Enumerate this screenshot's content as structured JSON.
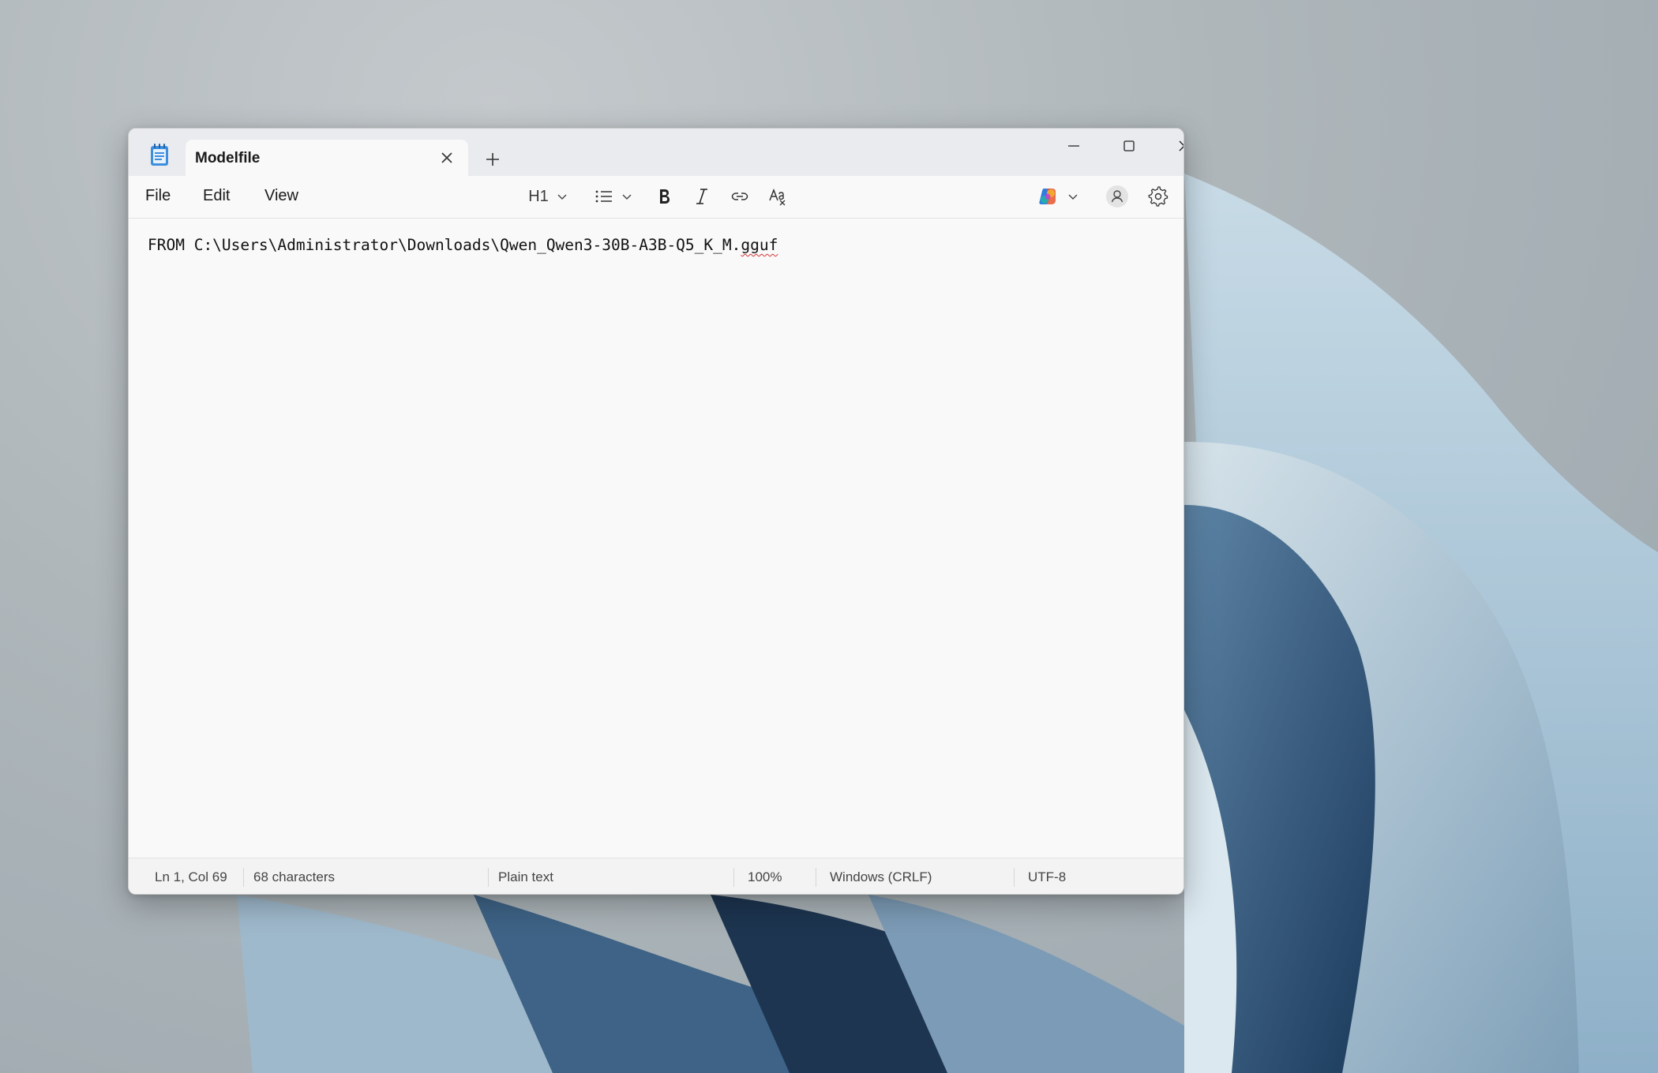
{
  "window": {
    "tab_title": "Modelfile"
  },
  "menu": {
    "file": "File",
    "edit": "Edit",
    "view": "View"
  },
  "toolbar": {
    "heading_label": "H1"
  },
  "editor": {
    "text_main": "FROM C:\\Users\\Administrator\\Downloads\\Qwen_Qwen3-30B-A3B-Q5_K_M.",
    "text_misspelled": "gguf"
  },
  "status": {
    "position": "Ln 1, Col 69",
    "characters": "68 characters",
    "format": "Plain text",
    "zoom": "100%",
    "line_ending": "Windows (CRLF)",
    "encoding": "UTF-8"
  },
  "icons": {
    "app": "notepad-icon",
    "close_tab": "close-icon",
    "new_tab": "plus-icon",
    "minimize": "minimize-icon",
    "maximize": "maximize-icon",
    "close_window": "close-icon",
    "heading_dropdown": "chevron-down-icon",
    "list": "bulleted-list-icon",
    "bold": "bold-icon",
    "italic": "italic-icon",
    "link": "link-icon",
    "clear_formatting": "clear-formatting-icon",
    "copilot": "copilot-icon",
    "account": "account-icon",
    "settings": "gear-icon"
  },
  "colors": {
    "accent": "#0f5fc2",
    "spellcheck": "#d13438"
  }
}
